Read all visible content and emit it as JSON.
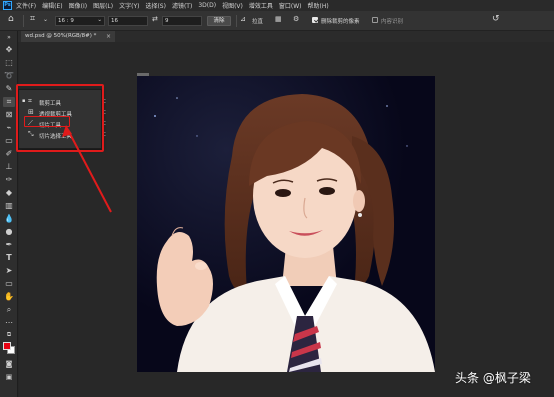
{
  "app": {
    "logo": "Ps"
  },
  "menu": [
    "文件(F)",
    "编辑(E)",
    "图像(I)",
    "图层(L)",
    "文字(Y)",
    "选择(S)",
    "滤镜(T)",
    "3D(D)",
    "视图(V)",
    "增效工具",
    "窗口(W)",
    "帮助(H)"
  ],
  "options": {
    "ratio_value": "16 : 9",
    "width_value": "16",
    "height_value": "9",
    "clear_label": "清除",
    "straighten_label": "拉直",
    "delete_cropped_label": "删除裁剪的像素",
    "delete_cropped_checked": true,
    "content_aware_label": "内容识别",
    "content_aware_checked": false
  },
  "document": {
    "tab_title": "wd.psd @ 50%(RGB/8#) *",
    "close_glyph": "×"
  },
  "flyout": {
    "items": [
      {
        "label": "裁剪工具",
        "key": "C",
        "icon": "crop-icon",
        "current": true
      },
      {
        "label": "透视裁剪工具",
        "key": "C",
        "icon": "perspective-crop-icon",
        "current": false
      },
      {
        "label": "切片工具",
        "key": "C",
        "icon": "slice-icon",
        "current": false
      },
      {
        "label": "切片选择工具",
        "key": "C",
        "icon": "slice-select-icon",
        "current": false
      }
    ]
  },
  "colors": {
    "foreground": "#e60012",
    "background": "#ffffff",
    "annotation": "#e01b1b"
  },
  "watermark": "头条 @枫子梁"
}
